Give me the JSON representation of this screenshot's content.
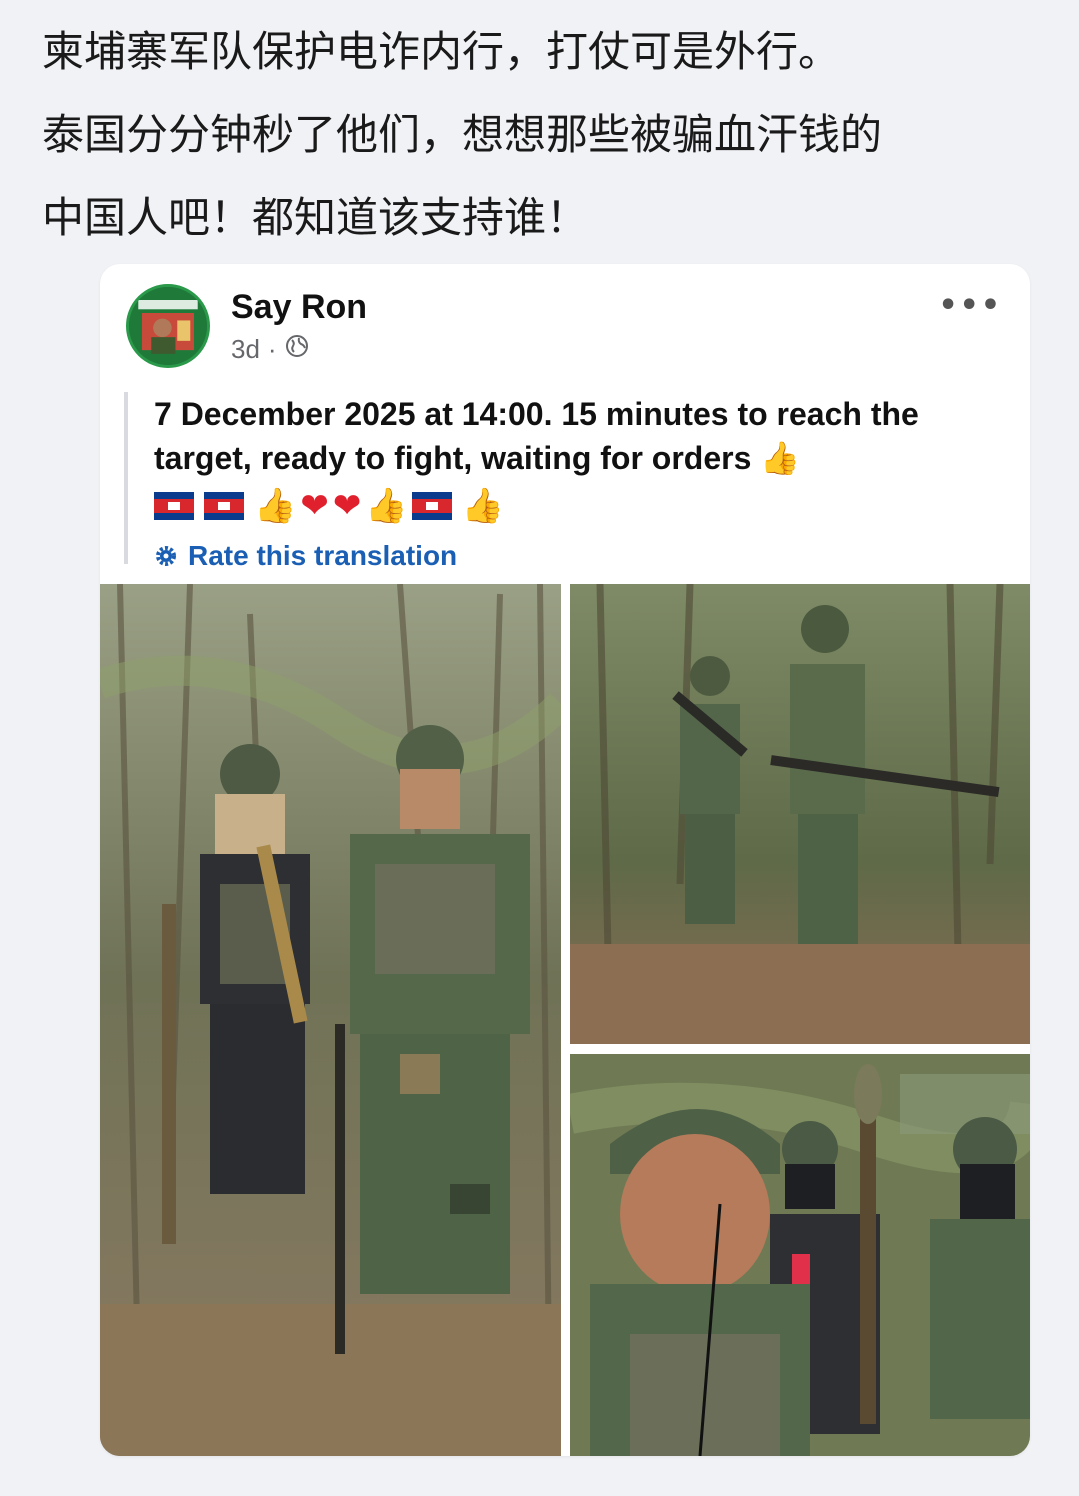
{
  "caption": {
    "lines": [
      "柬埔寨军队保护电诈内行，打仗可是外行。",
      "泰国分分钟秒了他们，想想那些被骗血汗钱的",
      "中国人吧！都知道该支持谁！"
    ]
  },
  "post": {
    "author": "Say Ron",
    "time": "3d",
    "separator": "·",
    "more_label": "•••",
    "text": "7 December 2025 at 14:00. 15 minutes to reach the target, ready to fight, waiting for orders 👍",
    "emoji_icons": [
      "cambodia-flag",
      "cambodia-flag",
      "thumbs-up",
      "heart",
      "heart",
      "thumbs-up",
      "cambodia-flag",
      "thumbs-up"
    ],
    "rate_translation": "Rate this translation"
  },
  "photos": [
    {
      "id": "photo-two-soldiers",
      "icon": "photo"
    },
    {
      "id": "photo-soldiers-forest",
      "icon": "photo"
    },
    {
      "id": "photo-selfie-group",
      "icon": "photo"
    }
  ],
  "colors": {
    "link": "#1a5fb4",
    "flag_blue": "#0a3b8c",
    "flag_red": "#d8282e",
    "heart": "#e0202c"
  }
}
